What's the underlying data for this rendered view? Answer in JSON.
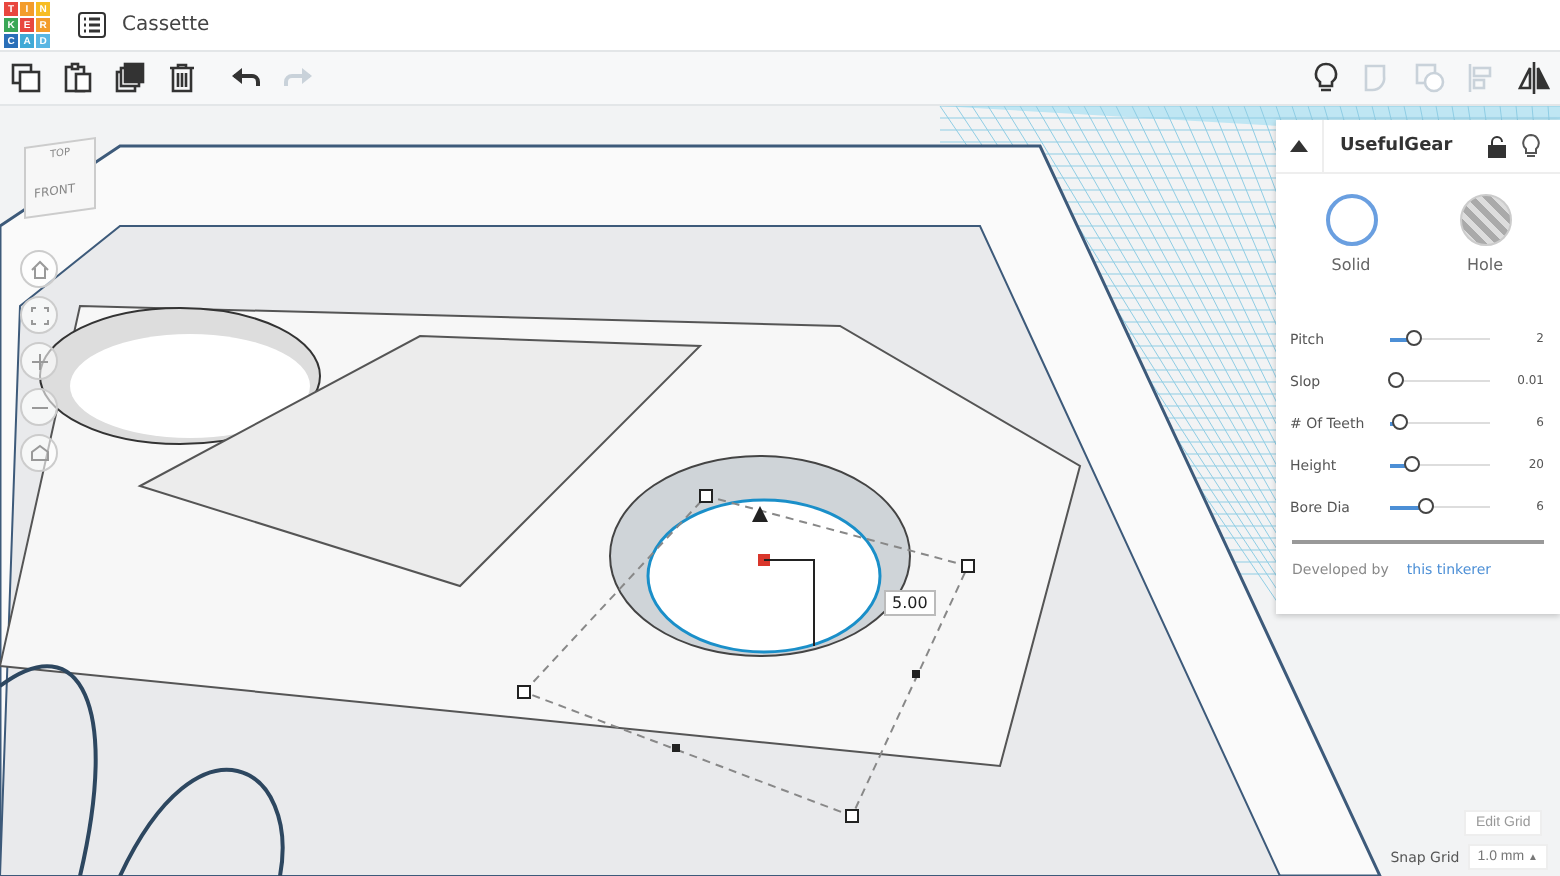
{
  "logo": {
    "rows": [
      [
        "T",
        "I",
        "N"
      ],
      [
        "K",
        "E",
        "R"
      ],
      [
        "C",
        "A",
        "D"
      ]
    ]
  },
  "window": {
    "title": "Cassette"
  },
  "toolbar": {
    "left": [
      {
        "kind": "copy",
        "disabled": false
      },
      {
        "kind": "paste",
        "disabled": false
      },
      {
        "kind": "duplicate",
        "disabled": false
      },
      {
        "kind": "delete",
        "disabled": false
      },
      {
        "kind": "undo",
        "disabled": false
      },
      {
        "kind": "redo",
        "disabled": true
      }
    ],
    "right": [
      {
        "kind": "bulb",
        "disabled": false
      },
      {
        "kind": "group",
        "disabled": true
      },
      {
        "kind": "ungroup",
        "disabled": true
      },
      {
        "kind": "align",
        "disabled": true
      },
      {
        "kind": "mirror",
        "disabled": false
      }
    ]
  },
  "view_cube": {
    "top": "TOP",
    "front": "FRONT"
  },
  "canvas": {
    "dimension": "5.00"
  },
  "panel": {
    "title": "UsefulGear",
    "expanded": true,
    "modes": [
      {
        "label": "Solid",
        "selected": true
      },
      {
        "label": "Hole",
        "selected": false
      }
    ],
    "params": [
      {
        "name": "Pitch",
        "level": 0.18,
        "value": "2"
      },
      {
        "name": "Slop",
        "level": 0,
        "value": "0.01"
      },
      {
        "name": "# Of Teeth",
        "level": 0.04,
        "value": "6"
      },
      {
        "name": "Height",
        "level": 0.16,
        "value": "20"
      },
      {
        "name": "Bore Dia",
        "level": 0.3,
        "value": "6"
      }
    ],
    "credit": "Developed by",
    "credit_link": "this tinkerer"
  },
  "edit_grid": "Edit Grid",
  "snap_grid": {
    "label": "Snap Grid",
    "value": "1.0 mm",
    "caret": "▲"
  }
}
